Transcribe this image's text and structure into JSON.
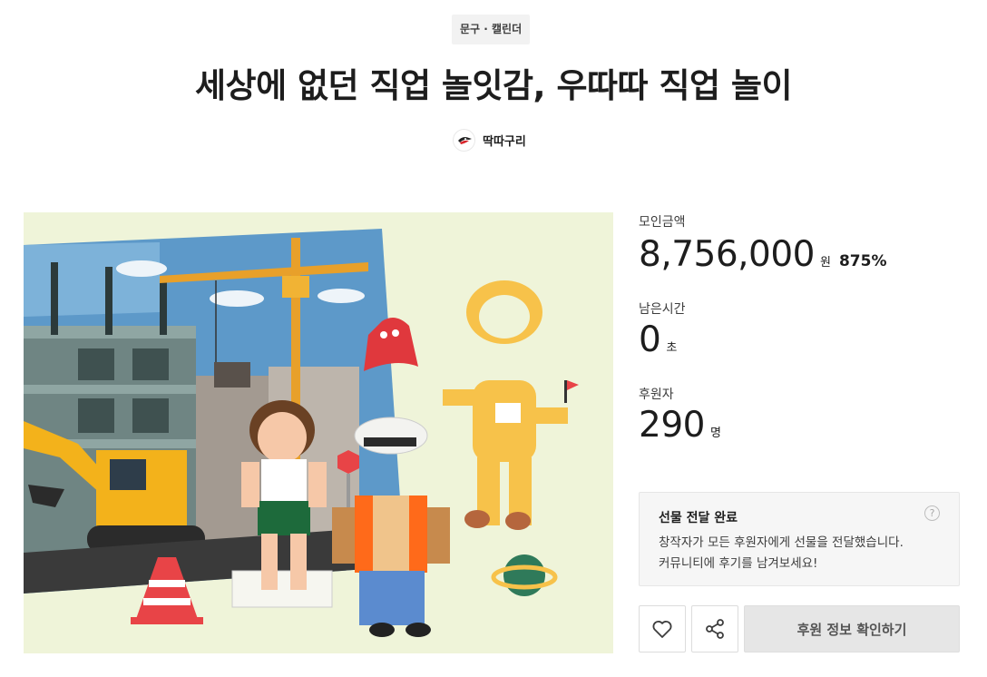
{
  "project": {
    "category": "문구 · 캘린더",
    "title": "세상에 없던 직업 놀잇감, 우따따 직업 놀이",
    "creator_name": "딱따구리",
    "creator_avatar_icon": "woodpecker-logo-icon"
  },
  "hero_image": {
    "icon": "illustration-construction-job-play-figures",
    "background_color": "#eff4d9"
  },
  "stats": {
    "funding_label": "모인금액",
    "funding_value": "8,756,000",
    "funding_unit": "원",
    "funding_percent": "875%",
    "time_label": "남은시간",
    "time_value": "0",
    "time_unit": "초",
    "backers_label": "후원자",
    "backers_value": "290",
    "backers_unit": "명"
  },
  "notice": {
    "title": "선물 전달 완료",
    "line1": "창작자가 모든 후원자에게 선물을 전달했습니다.",
    "line2": "커뮤니티에 후기를 남겨보세요!",
    "help_icon": "question-circle-icon",
    "help_glyph": "?"
  },
  "actions": {
    "like_icon": "heart-icon",
    "share_icon": "share-icon",
    "primary_label": "후원 정보 확인하기"
  }
}
